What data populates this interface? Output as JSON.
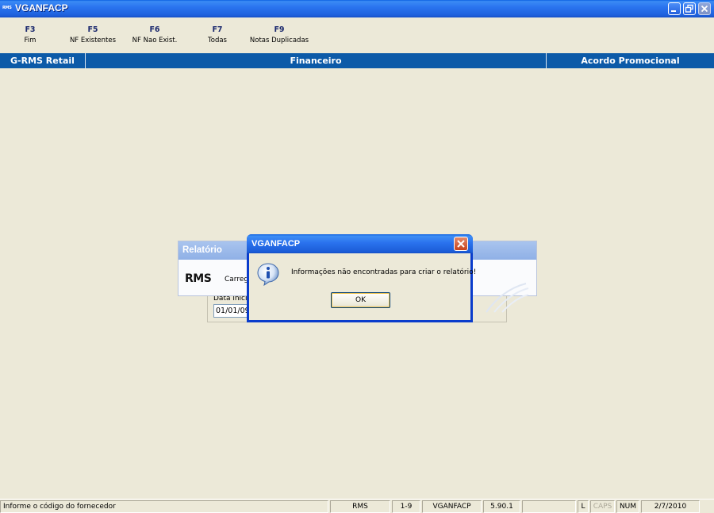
{
  "window": {
    "app_icon_text": "RMS",
    "title": "VGANFACP",
    "controls": [
      "minimize",
      "restore",
      "close"
    ]
  },
  "function_keys": [
    {
      "key": "F3",
      "label": "Fim"
    },
    {
      "key": "F5",
      "label": "NF Existentes"
    },
    {
      "key": "F6",
      "label": "NF Nao Exist."
    },
    {
      "key": "F7",
      "label": "Todas"
    },
    {
      "key": "F9",
      "label": "Notas Duplicadas"
    }
  ],
  "header_band": {
    "left": "G-RMS Retail",
    "center": "Financeiro",
    "right": "Acordo Promocional"
  },
  "report_window": {
    "title": "Relatório",
    "logo_text": "RMS",
    "status_text": "Carreg",
    "date_label": "Data inicia",
    "date_value": "01/01/09"
  },
  "message_box": {
    "title": "VGANFACP",
    "icon": "info-icon",
    "text": "Informações não encontradas para criar o relatório!",
    "ok_label": "OK"
  },
  "status_bar": {
    "message": "Informe o código do fornecedor",
    "system": "RMS",
    "range": "1-9",
    "program": "VGANFACP",
    "version": "5.90.1",
    "blank": "",
    "l_indicator": "L",
    "caps_indicator": "CAPS",
    "num_indicator": "NUM",
    "date": "2/7/2010"
  },
  "colors": {
    "titlebar_blue": "#2a74ef",
    "band_blue": "#0c5aa8",
    "face": "#ece9d8",
    "fkey_text": "#1c2a6e"
  }
}
